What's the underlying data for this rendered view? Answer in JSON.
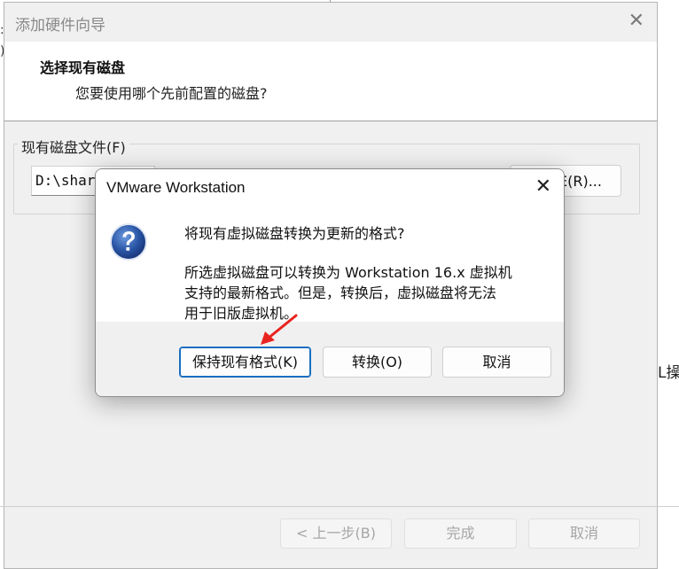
{
  "background": {
    "left_mark_1": ":",
    "left_mark_2": ")",
    "right_text": "L操作"
  },
  "wizard": {
    "title": "添加硬件向导",
    "header_title": "选择现有磁盘",
    "header_subtitle": "您要使用哪个先前配置的磁盘?",
    "group_label": "现有磁盘文件(F)",
    "path_value": "D:\\share",
    "browse_label": "E(R)...",
    "back_label": "< 上一步(B)",
    "finish_label": "完成",
    "cancel_label": "取消"
  },
  "dialog": {
    "title": "VMware Workstation",
    "main_question": "将现有虚拟磁盘转换为更新的格式?",
    "detail_line1": "所选虚拟磁盘可以转换为 Workstation 16.x 虚拟机",
    "detail_line2": "支持的最新格式。但是，转换后，虚拟磁盘将无法",
    "detail_line3": "用于旧版虚拟机。",
    "keep_label": "保持现有格式(K)",
    "convert_label": "转换(O)",
    "cancel_label": "取消"
  },
  "icons": {
    "close": "close-icon",
    "question": "question-icon",
    "annotation": "red-arrow-icon"
  },
  "colors": {
    "default_button_border": "#1a6ec0",
    "question_icon": "#2a56a6",
    "annotation_arrow": "#e8231f"
  }
}
